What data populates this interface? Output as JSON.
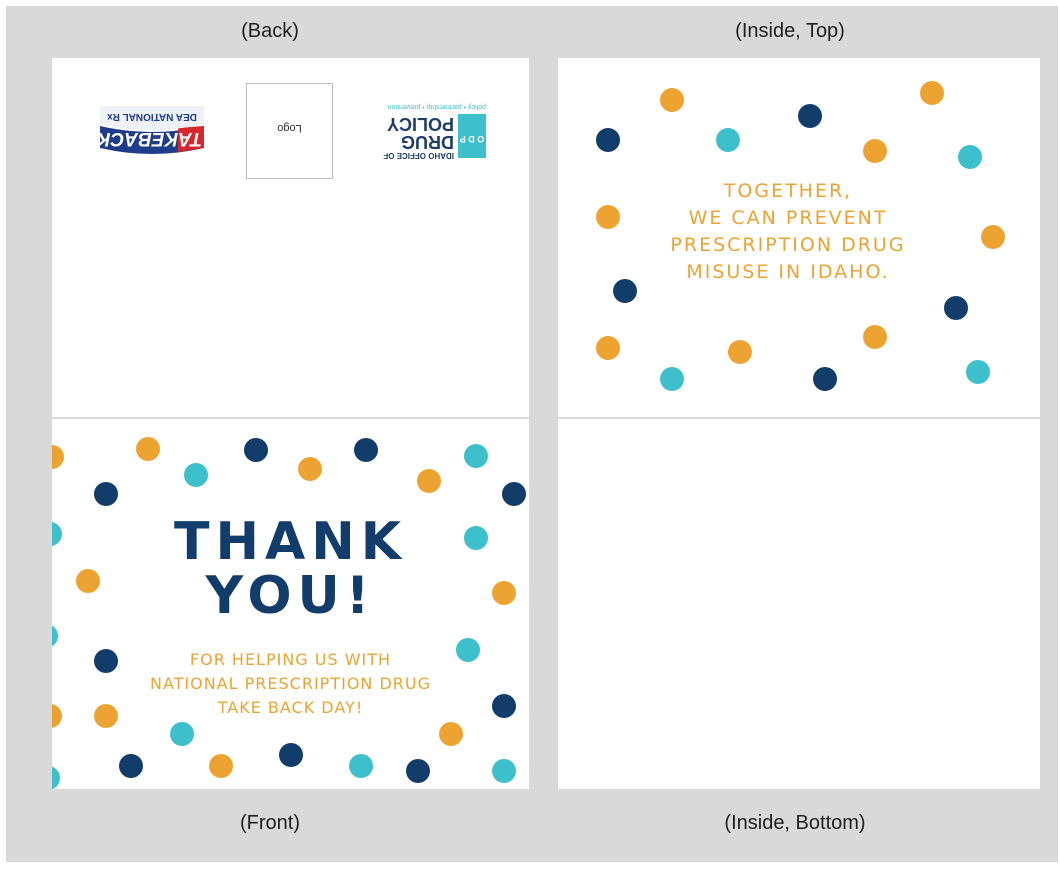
{
  "captions": {
    "back": "(Back)",
    "inside_top": "(Inside, Top)",
    "front": "(Front)",
    "inside_bottom": "(Inside, Bottom)"
  },
  "back": {
    "logo_placeholder": "Logo",
    "takeback_logo": {
      "line1": "TAKEBACK",
      "line2": "DEA NATIONAL Rx"
    },
    "odp_logo": {
      "letters": "O D P",
      "line1": "IDAHO OFFICE OF",
      "line2": "DRUG",
      "line3": "POLICY",
      "tagline": "policy • partnership • prevention"
    }
  },
  "inside_top": {
    "lines": [
      "TOGETHER,",
      "WE CAN PREVENT",
      "PRESCRIPTION DRUG",
      "MISUSE IN IDAHO."
    ]
  },
  "front": {
    "title_line1": "THANK",
    "title_line2": "YOU!",
    "sub_lines": [
      "FOR HELPING US WITH",
      "NATIONAL PRESCRIPTION DRUG",
      "TAKE BACK DAY!"
    ]
  },
  "colors": {
    "orange": "#eda332",
    "teal": "#3ebfcc",
    "navy": "#123c69",
    "background": "#d9d9d9"
  }
}
